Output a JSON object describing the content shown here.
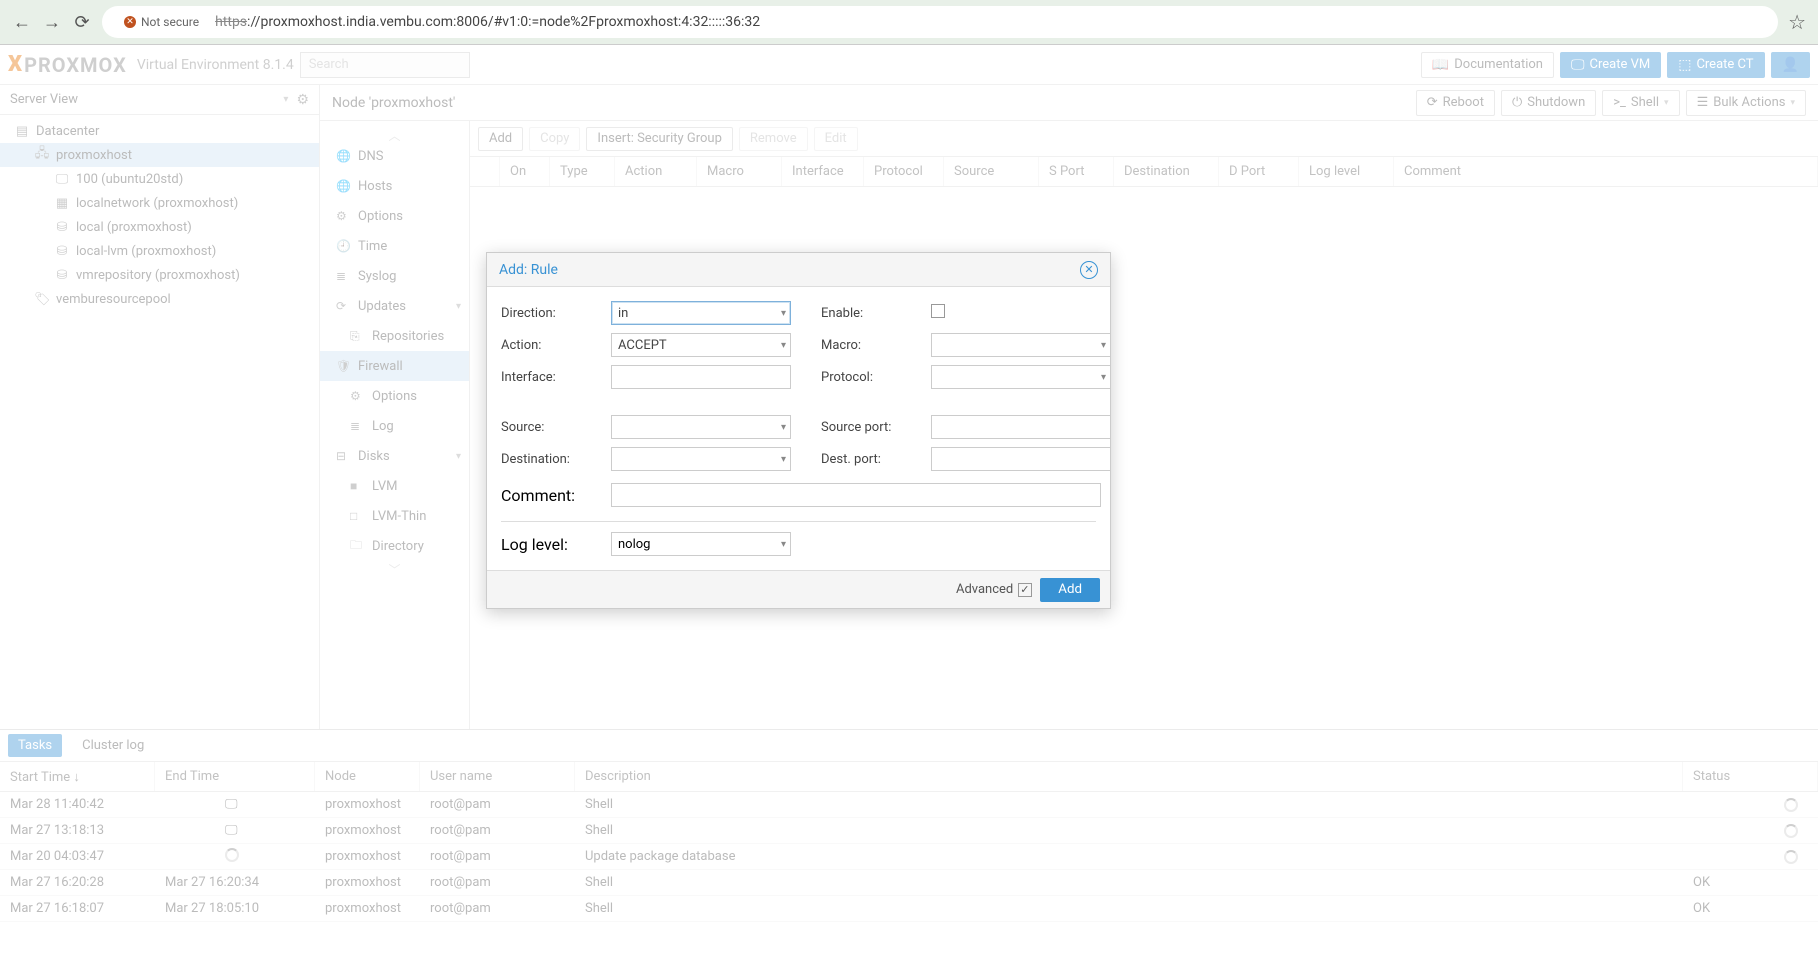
{
  "browser": {
    "not_secure": "Not secure",
    "url_prefix": "https",
    "url_rest": "://proxmoxhost.india.vembu.com:8006/#v1:0:=node%2Fproxmoxhost:4:32:::::36:32"
  },
  "header": {
    "logo1": "X",
    "logo2": "PROXMOX",
    "env": "Virtual Environment 8.1.4",
    "search_placeholder": "Search",
    "doc": "Documentation",
    "create_vm": "Create VM",
    "create_ct": "Create CT"
  },
  "left": {
    "title": "Server View",
    "items": [
      {
        "ic": "▤",
        "label": "Datacenter",
        "lvl": 0,
        "sel": false
      },
      {
        "ic": "🖧",
        "label": "proxmoxhost",
        "lvl": 1,
        "sel": true
      },
      {
        "ic": "🖵",
        "label": "100 (ubuntu20std)",
        "lvl": 2,
        "sel": false
      },
      {
        "ic": "▦",
        "label": "localnetwork (proxmoxhost)",
        "lvl": 2,
        "sel": false
      },
      {
        "ic": "⛁",
        "label": "local (proxmoxhost)",
        "lvl": 2,
        "sel": false
      },
      {
        "ic": "⛁",
        "label": "local-lvm (proxmoxhost)",
        "lvl": 2,
        "sel": false
      },
      {
        "ic": "⛁",
        "label": "vmrepository (proxmoxhost)",
        "lvl": 2,
        "sel": false
      },
      {
        "ic": "🏷",
        "label": "vemburesourcepool",
        "lvl": 1,
        "sel": false
      }
    ]
  },
  "node": {
    "title": "Node 'proxmoxhost'",
    "reboot": "Reboot",
    "shutdown": "Shutdown",
    "shell": "Shell",
    "bulk": "Bulk Actions"
  },
  "nav": [
    {
      "ic": "🌐",
      "label": "DNS",
      "sub": false,
      "sel": false,
      "chev": false
    },
    {
      "ic": "🌐",
      "label": "Hosts",
      "sub": false,
      "sel": false,
      "chev": false
    },
    {
      "ic": "⚙",
      "label": "Options",
      "sub": false,
      "sel": false,
      "chev": false
    },
    {
      "ic": "🕘",
      "label": "Time",
      "sub": false,
      "sel": false,
      "chev": false
    },
    {
      "ic": "≣",
      "label": "Syslog",
      "sub": false,
      "sel": false,
      "chev": false
    },
    {
      "ic": "⟳",
      "label": "Updates",
      "sub": false,
      "sel": false,
      "chev": true
    },
    {
      "ic": "⎘",
      "label": "Repositories",
      "sub": true,
      "sel": false,
      "chev": false
    },
    {
      "ic": "🛡",
      "label": "Firewall",
      "sub": false,
      "sel": true,
      "chev": false
    },
    {
      "ic": "⚙",
      "label": "Options",
      "sub": true,
      "sel": false,
      "chev": false
    },
    {
      "ic": "≣",
      "label": "Log",
      "sub": true,
      "sel": false,
      "chev": false
    },
    {
      "ic": "⊟",
      "label": "Disks",
      "sub": false,
      "sel": false,
      "chev": true
    },
    {
      "ic": "■",
      "label": "LVM",
      "sub": true,
      "sel": false,
      "chev": false
    },
    {
      "ic": "□",
      "label": "LVM-Thin",
      "sub": true,
      "sel": false,
      "chev": false
    },
    {
      "ic": "🗀",
      "label": "Directory",
      "sub": true,
      "sel": false,
      "chev": false
    }
  ],
  "toolbar": {
    "add": "Add",
    "copy": "Copy",
    "insert": "Insert: Security Group",
    "remove": "Remove",
    "edit": "Edit"
  },
  "cols": [
    "",
    "On",
    "Type",
    "Action",
    "Macro",
    "Interface",
    "Protocol",
    "Source",
    "S Port",
    "Destination",
    "D Port",
    "Log level",
    "Comment"
  ],
  "modal": {
    "title": "Add: Rule",
    "labels": {
      "direction": "Direction:",
      "action": "Action:",
      "interface": "Interface:",
      "enable": "Enable:",
      "macro": "Macro:",
      "protocol": "Protocol:",
      "source": "Source:",
      "destination": "Destination:",
      "source_port": "Source port:",
      "dest_port": "Dest. port:",
      "comment": "Comment:",
      "log_level": "Log level:"
    },
    "values": {
      "direction": "in",
      "action": "ACCEPT",
      "log_level": "nolog"
    },
    "advanced": "Advanced",
    "add_btn": "Add"
  },
  "tabs": {
    "tasks": "Tasks",
    "cluster_log": "Cluster log"
  },
  "task_cols": [
    "Start Time ↓",
    "End Time",
    "Node",
    "User name",
    "Description",
    "Status"
  ],
  "tasks": [
    {
      "start": "Mar 28 11:40:42",
      "end": "",
      "end_ic": "mon",
      "node": "proxmoxhost",
      "user": "root@pam",
      "desc": "Shell",
      "status": "",
      "spin": true
    },
    {
      "start": "Mar 27 13:18:13",
      "end": "",
      "end_ic": "mon",
      "node": "proxmoxhost",
      "user": "root@pam",
      "desc": "Shell",
      "status": "",
      "spin": true
    },
    {
      "start": "Mar 20 04:03:47",
      "end": "",
      "end_ic": "spin",
      "node": "proxmoxhost",
      "user": "root@pam",
      "desc": "Update package database",
      "status": "",
      "spin": true
    },
    {
      "start": "Mar 27 16:20:28",
      "end": "Mar 27 16:20:34",
      "end_ic": "",
      "node": "proxmoxhost",
      "user": "root@pam",
      "desc": "Shell",
      "status": "OK",
      "spin": false
    },
    {
      "start": "Mar 27 16:18:07",
      "end": "Mar 27 18:05:10",
      "end_ic": "",
      "node": "proxmoxhost",
      "user": "root@pam",
      "desc": "Shell",
      "status": "OK",
      "spin": false
    }
  ]
}
